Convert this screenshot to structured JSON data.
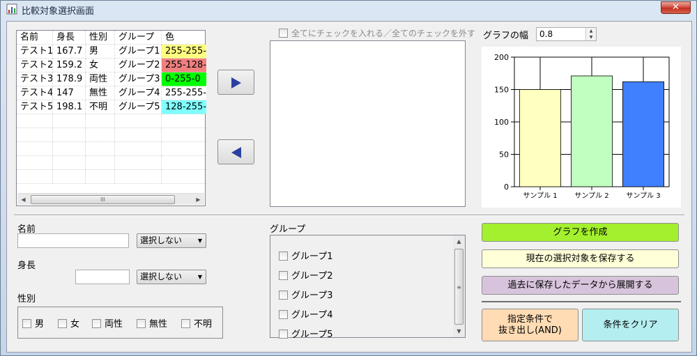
{
  "window": {
    "title": "比較対象選択画面",
    "close_label": "✕"
  },
  "grid": {
    "columns": [
      "名前",
      "身長",
      "性別",
      "グループ",
      "色"
    ],
    "rows": [
      {
        "name": "テスト1",
        "height": "167.7",
        "gender": "男",
        "group": "グループ1",
        "color": "255-255-",
        "bg": "#ffff80"
      },
      {
        "name": "テスト2",
        "height": "159.2",
        "gender": "女",
        "group": "グループ2",
        "color": "255-128-",
        "bg": "#f08080"
      },
      {
        "name": "テスト3",
        "height": "178.9",
        "gender": "両性",
        "group": "グループ3",
        "color": "0-255-0",
        "bg": "#00ff00"
      },
      {
        "name": "テスト4",
        "height": "147",
        "gender": "無性",
        "group": "グループ4",
        "color": "255-255-",
        "bg": "#ffffff"
      },
      {
        "name": "テスト5",
        "height": "198.1",
        "gender": "不明",
        "group": "グループ5",
        "color": "128-255-",
        "bg": "#80ffff"
      }
    ],
    "scroll_grip": "III"
  },
  "select_all_label": "全てにチェックを入れる／全てのチェックを外す",
  "graph_width": {
    "label": "グラフの幅",
    "value": "0.8"
  },
  "chart_data": {
    "type": "bar",
    "categories": [
      "サンプル 1",
      "サンプル 2",
      "サンプル 3"
    ],
    "values": [
      150,
      171,
      162
    ],
    "colors": [
      "#ffffc0",
      "#c0ffc0",
      "#4080ff"
    ],
    "yticks": [
      "0",
      "50",
      "100",
      "150",
      "200"
    ],
    "ylim": [
      0,
      200
    ],
    "grid": true
  },
  "filters": {
    "name_label": "名前",
    "name_value": "",
    "name_mode": "選択しない",
    "height_label": "身長",
    "height_value": "",
    "height_mode": "選択しない",
    "gender_label": "性別",
    "genders": [
      "男",
      "女",
      "両性",
      "無性",
      "不明"
    ],
    "group_label": "グループ",
    "groups": [
      "グループ1",
      "グループ2",
      "グループ3",
      "グループ4",
      "グループ5"
    ],
    "scroll_grip": "≡"
  },
  "actions": {
    "make_graph": "グラフを作成",
    "save_selection": "現在の選択対象を保存する",
    "load_saved": "過去に保存したデータから展開する",
    "extract_line1": "指定条件で",
    "extract_line2": "抜き出し(AND)",
    "clear": "条件をクリア"
  },
  "colors": {
    "make_graph": "#a3f02e",
    "save_selection": "#ffffd8",
    "load_saved": "#d8c3dc",
    "extract": "#ffdcb4",
    "clear": "#b4eef0"
  }
}
